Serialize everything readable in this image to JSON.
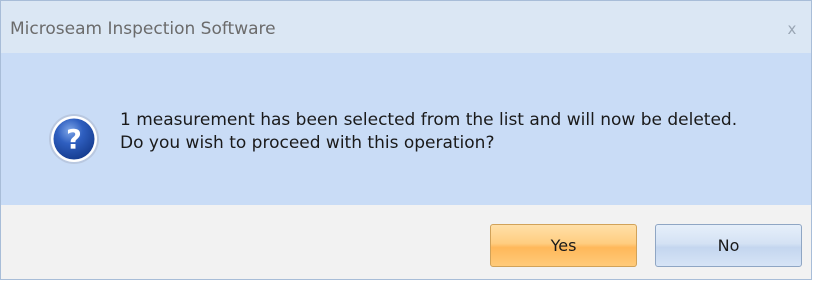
{
  "dialog": {
    "title": "Microseam Inspection Software",
    "close_glyph": "x",
    "icon": "question-icon",
    "message_lines": [
      "1 measurement has been selected from the list and will now be deleted.",
      "Do you wish to proceed with this operation?"
    ],
    "buttons": {
      "yes_label": "Yes",
      "no_label": "No"
    }
  },
  "colors": {
    "titlebar": "#dbe7f4",
    "content": "#c9dcf6",
    "footer": "#f2f2f2",
    "yes_button": "#ffcd80",
    "no_button": "#d4e2f4",
    "icon_blue": "#1f4aa6"
  }
}
